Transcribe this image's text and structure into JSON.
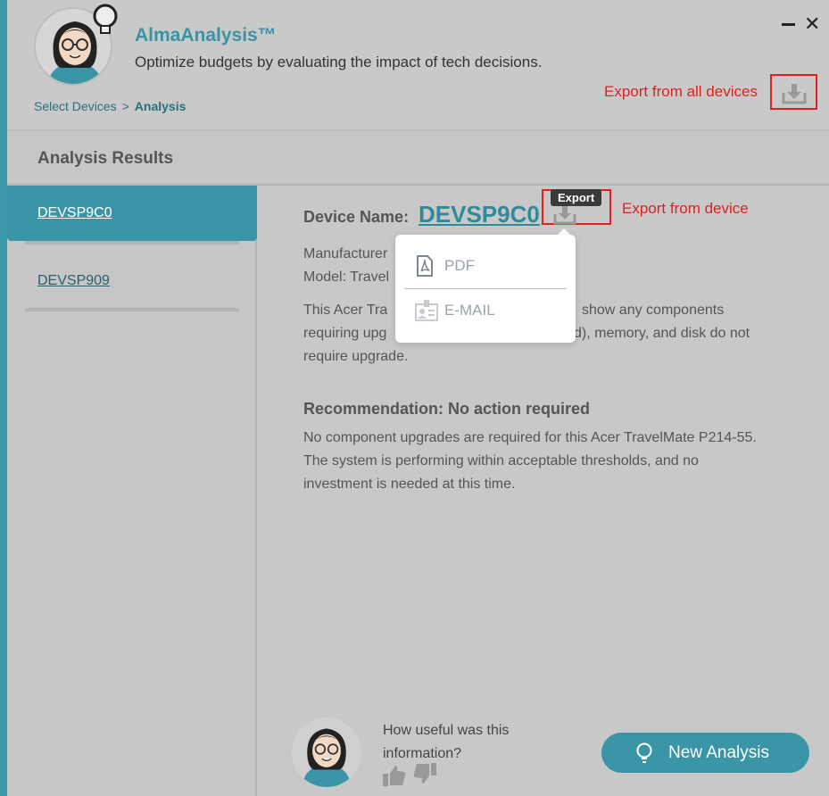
{
  "header": {
    "app_title": "AlmaAnalysis™",
    "subtitle": "Optimize budgets by evaluating the impact of tech decisions.",
    "breadcrumb": {
      "step1": "Select Devices",
      "separator": ">",
      "current": "Analysis"
    },
    "export_all_annotation": "Export from all devices"
  },
  "results": {
    "title": "Analysis Results"
  },
  "sidebar": {
    "items": [
      {
        "label": "DEVSP9C0",
        "active": true
      },
      {
        "label": "DEVSP909",
        "active": false
      }
    ]
  },
  "content": {
    "device_name_label": "Device Name:",
    "device_name": "DEVSP9C0",
    "export_tooltip": "Export",
    "export_device_annotation": "Export from device",
    "manufacturer_visible": "Manufacturer",
    "model_visible": "Model: Travel",
    "desc_line1_a": "This Acer Tra",
    "desc_line1_b": "show any components",
    "desc_line2_a": "requiring upg",
    "desc_line2_b": "d), memory, and disk do not",
    "desc_line3": "require upgrade.",
    "recommendation_title": "Recommendation: No action required",
    "rec_line1": "No component upgrades are required for this Acer TravelMate P214-55.",
    "rec_line2": "The system is performing within acceptable thresholds, and no",
    "rec_line3": "investment is needed at this time."
  },
  "export_menu": {
    "items": [
      {
        "label": "PDF",
        "icon": "pdf-icon"
      },
      {
        "label": "E-MAIL",
        "icon": "contact-card-icon"
      }
    ]
  },
  "feedback": {
    "question_line1": "How useful was this",
    "question_line2": "information?"
  },
  "new_analysis": {
    "label": "New Analysis"
  },
  "colors": {
    "accent": "#3a96a6",
    "annotation": "#e02020",
    "title": "#3a93a4"
  }
}
